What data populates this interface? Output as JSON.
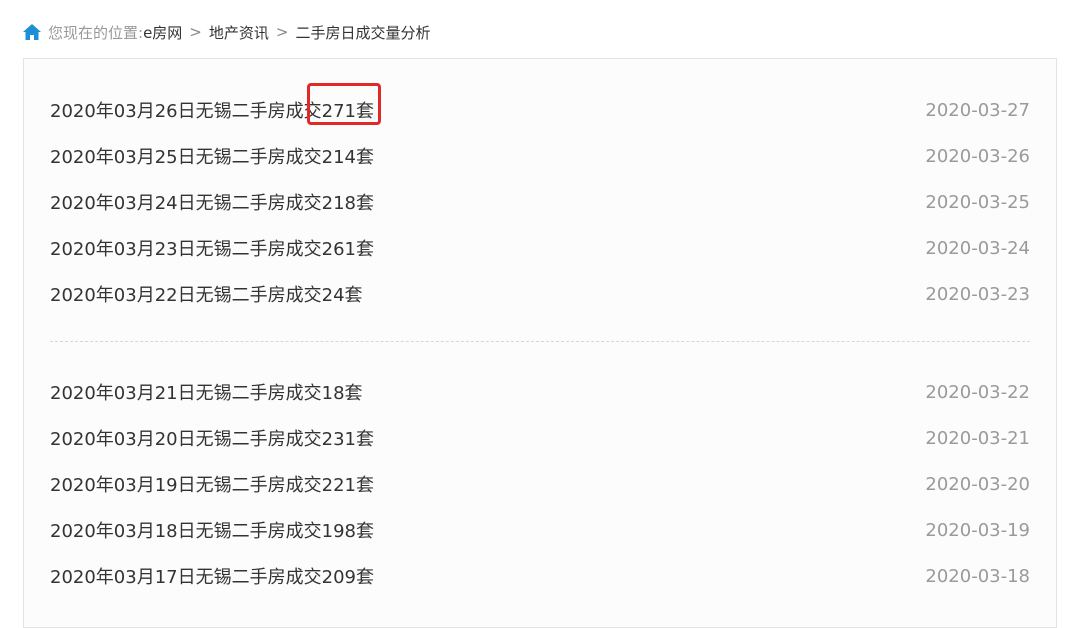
{
  "breadcrumb": {
    "prefix": "您现在的位置:",
    "items": [
      "e房网",
      "地产资讯",
      "二手房日成交量分析"
    ],
    "separator": ">"
  },
  "group_a": [
    {
      "title": "2020年03月26日无锡二手房成交271套",
      "date": "2020-03-27"
    },
    {
      "title": "2020年03月25日无锡二手房成交214套",
      "date": "2020-03-26"
    },
    {
      "title": "2020年03月24日无锡二手房成交218套",
      "date": "2020-03-25"
    },
    {
      "title": "2020年03月23日无锡二手房成交261套",
      "date": "2020-03-24"
    },
    {
      "title": "2020年03月22日无锡二手房成交24套",
      "date": "2020-03-23"
    }
  ],
  "group_b": [
    {
      "title": "2020年03月21日无锡二手房成交18套",
      "date": "2020-03-22"
    },
    {
      "title": "2020年03月20日无锡二手房成交231套",
      "date": "2020-03-21"
    },
    {
      "title": "2020年03月19日无锡二手房成交221套",
      "date": "2020-03-20"
    },
    {
      "title": "2020年03月18日无锡二手房成交198套",
      "date": "2020-03-19"
    },
    {
      "title": "2020年03月17日无锡二手房成交209套",
      "date": "2020-03-18"
    }
  ],
  "colors": {
    "home_icon": "#1e8fd6",
    "highlight": "#e02a2a",
    "title_text": "#333333",
    "date_text": "#9a9a9a"
  },
  "icons": {
    "home": "home-icon"
  }
}
